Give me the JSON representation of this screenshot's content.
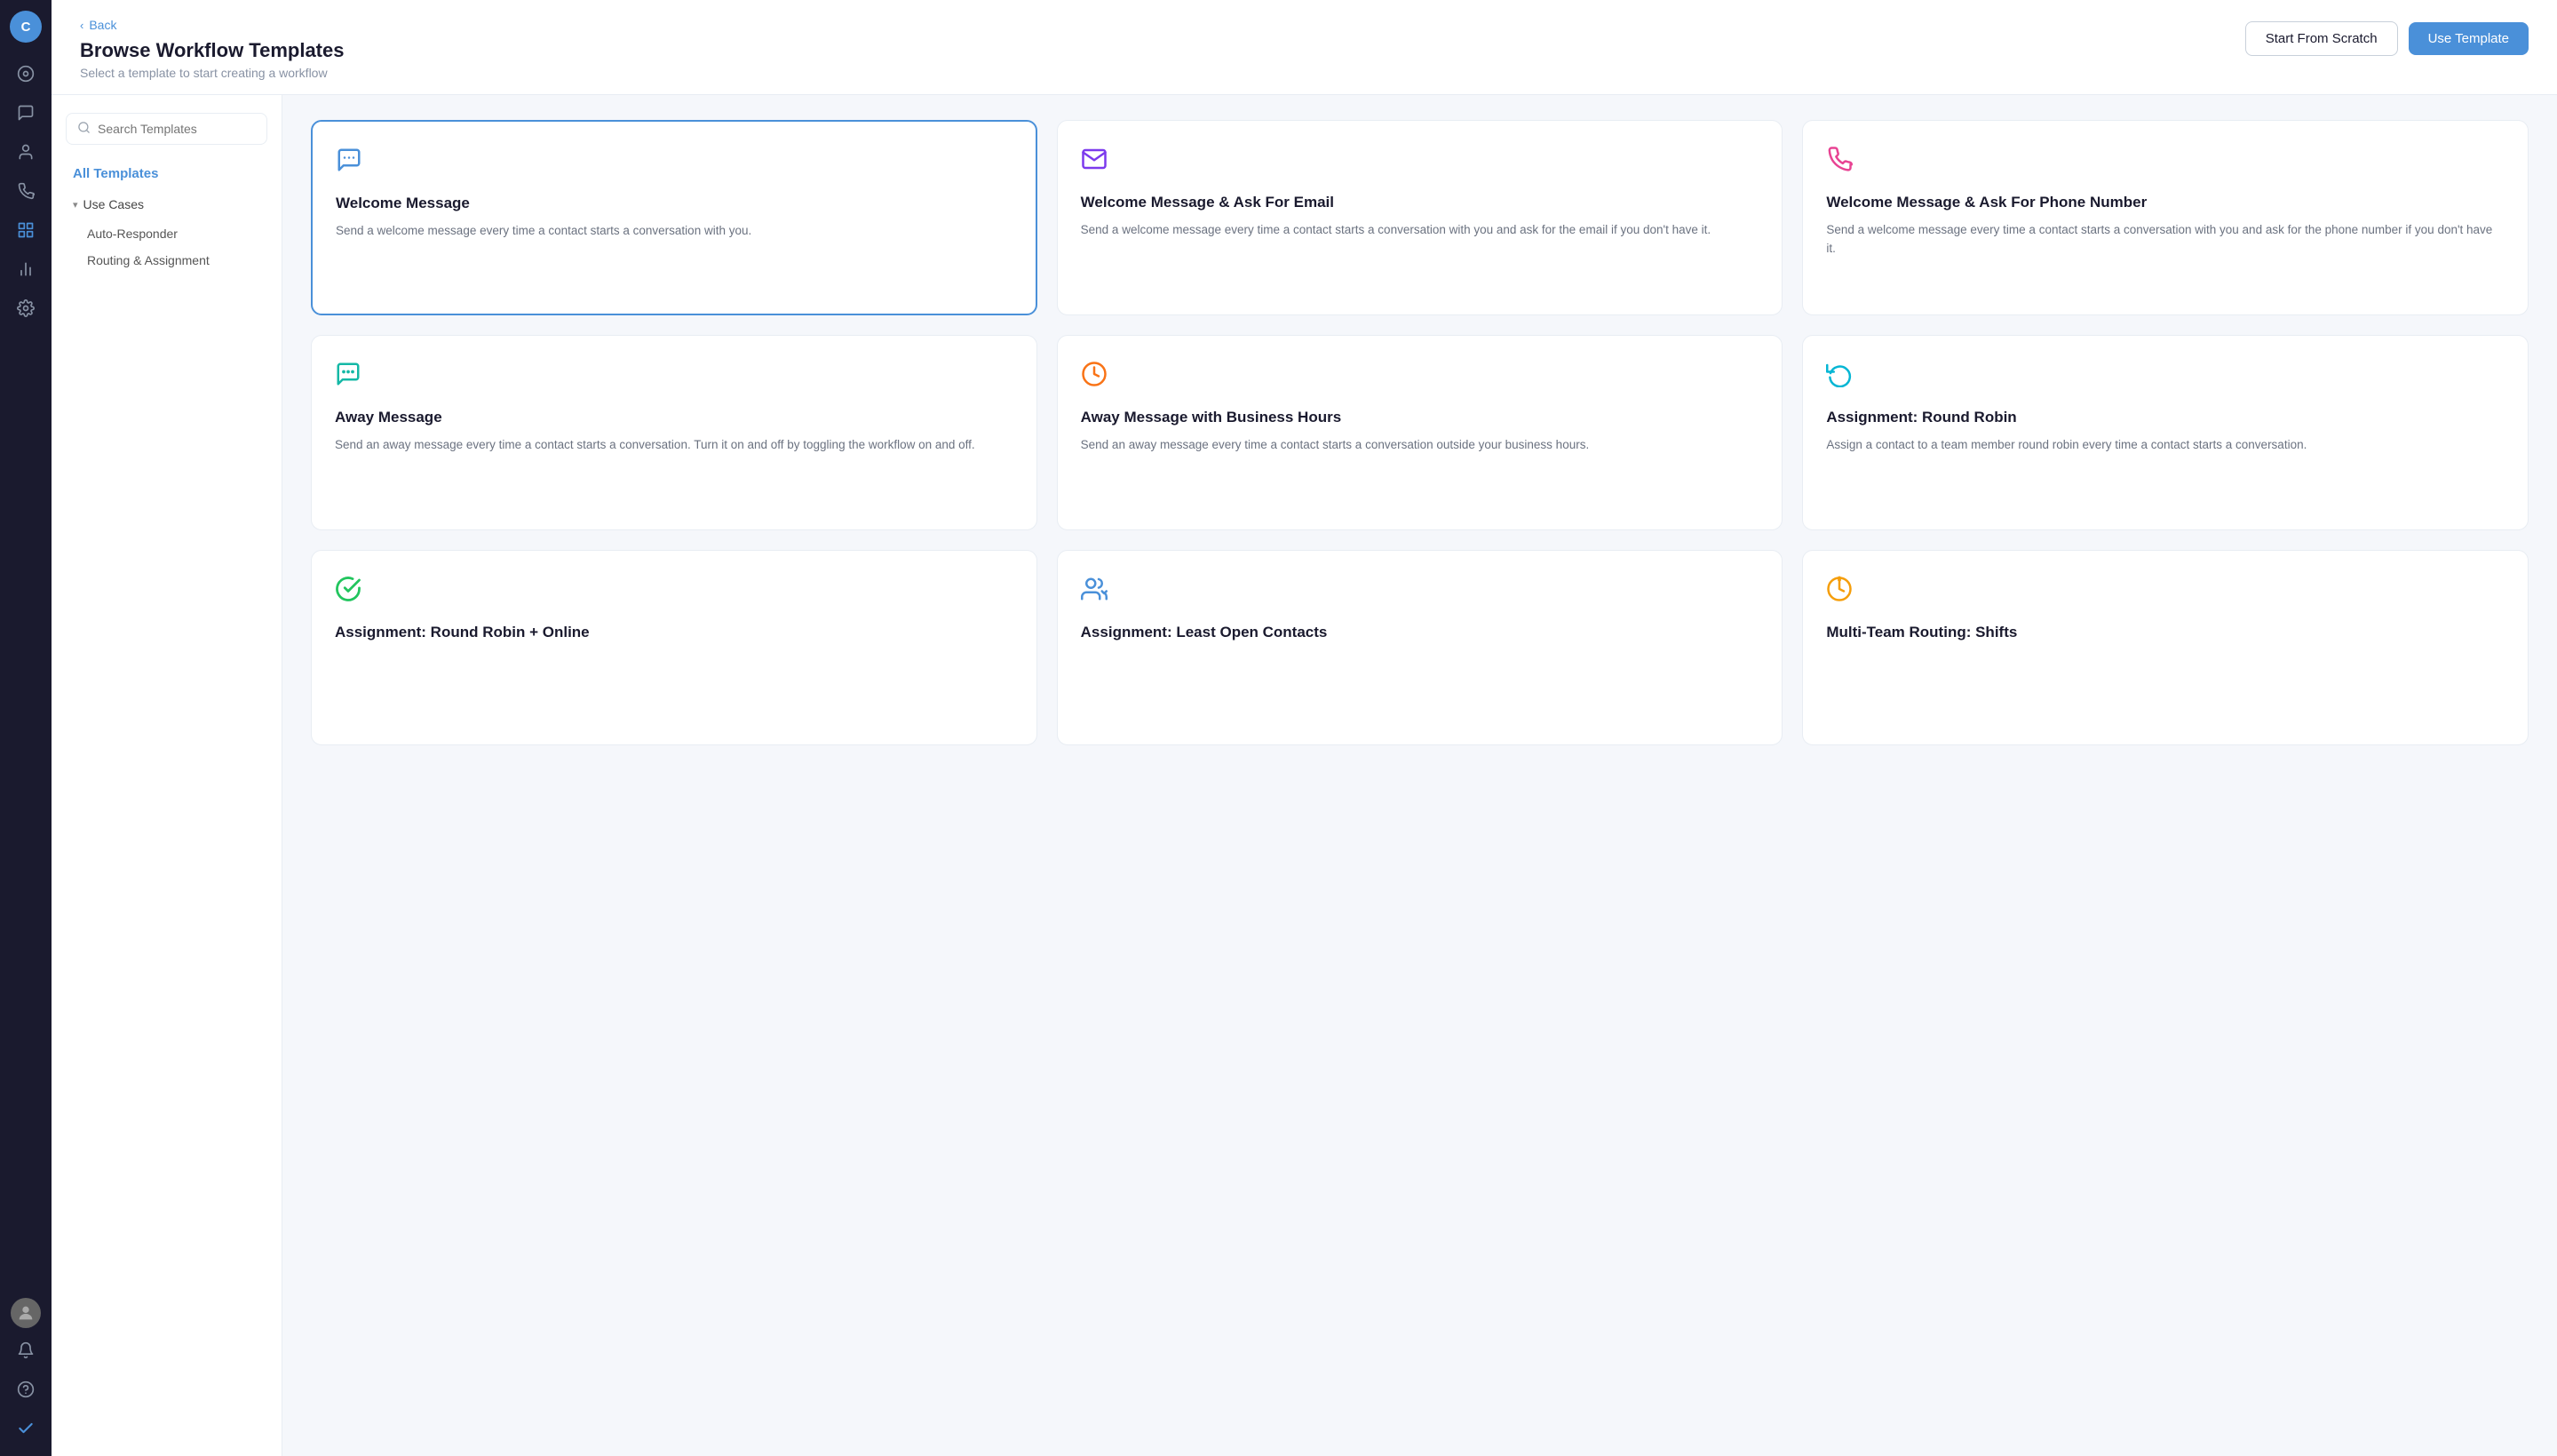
{
  "nav": {
    "avatar_label": "C",
    "icons": [
      {
        "name": "dashboard-icon",
        "glyph": "◎",
        "active": false
      },
      {
        "name": "chat-icon",
        "glyph": "💬",
        "active": false
      },
      {
        "name": "contacts-icon",
        "glyph": "👤",
        "active": false
      },
      {
        "name": "broadcast-icon",
        "glyph": "📡",
        "active": false
      },
      {
        "name": "workflow-icon",
        "glyph": "⬡",
        "active": true
      },
      {
        "name": "reports-icon",
        "glyph": "📊",
        "active": false
      },
      {
        "name": "settings-icon",
        "glyph": "⚙",
        "active": false
      }
    ],
    "bottom_icons": [
      {
        "name": "notification-icon",
        "glyph": "🔔"
      },
      {
        "name": "help-icon",
        "glyph": "❓"
      },
      {
        "name": "checkmark-icon",
        "glyph": "✔"
      }
    ]
  },
  "header": {
    "back_label": "Back",
    "title": "Browse Workflow Templates",
    "subtitle": "Select a template to start creating a workflow",
    "btn_scratch": "Start From Scratch",
    "btn_use": "Use Template"
  },
  "sidebar": {
    "search_placeholder": "Search Templates",
    "all_templates_label": "All Templates",
    "use_cases_label": "Use Cases",
    "categories": [
      {
        "label": "Auto-Responder"
      },
      {
        "label": "Routing & Assignment"
      }
    ]
  },
  "templates": [
    {
      "id": "welcome-message",
      "icon_class": "icon-blue",
      "icon_glyph": "🗨",
      "title": "Welcome Message",
      "description": "Send a welcome message every time a contact starts a conversation with you.",
      "selected": true
    },
    {
      "id": "welcome-email",
      "icon_class": "icon-purple",
      "icon_glyph": "✉",
      "title": "Welcome Message & Ask For Email",
      "description": "Send a welcome message every time a contact starts a conversation with you and ask for the email if you don't have it.",
      "selected": false
    },
    {
      "id": "welcome-phone",
      "icon_class": "icon-pink",
      "icon_glyph": "📞",
      "title": "Welcome Message & Ask For Phone Number",
      "description": "Send a welcome message every time a contact starts a conversation with you and ask for the phone number if you don't have it.",
      "selected": false
    },
    {
      "id": "away-message",
      "icon_class": "icon-teal",
      "icon_glyph": "💬",
      "title": "Away Message",
      "description": "Send an away message every time a contact starts a conversation. Turn it on and off by toggling the workflow on and off.",
      "selected": false
    },
    {
      "id": "away-business-hours",
      "icon_class": "icon-orange",
      "icon_glyph": "🕐",
      "title": "Away Message with Business Hours",
      "description": "Send an away message every time a contact starts a conversation outside your business hours.",
      "selected": false
    },
    {
      "id": "round-robin",
      "icon_class": "icon-cyan",
      "icon_glyph": "↻",
      "title": "Assignment: Round Robin",
      "description": "Assign a contact to a team member round robin every time a contact starts a conversation.",
      "selected": false
    },
    {
      "id": "round-robin-online",
      "icon_class": "icon-green",
      "icon_glyph": "✓",
      "title": "Assignment: Round Robin + Online",
      "description": "",
      "selected": false
    },
    {
      "id": "least-open",
      "icon_class": "icon-blue",
      "icon_glyph": "👥",
      "title": "Assignment: Least Open Contacts",
      "description": "",
      "selected": false
    },
    {
      "id": "multi-team-shifts",
      "icon_class": "icon-amber",
      "icon_glyph": "⏱",
      "title": "Multi-Team Routing: Shifts",
      "description": "",
      "selected": false
    }
  ]
}
